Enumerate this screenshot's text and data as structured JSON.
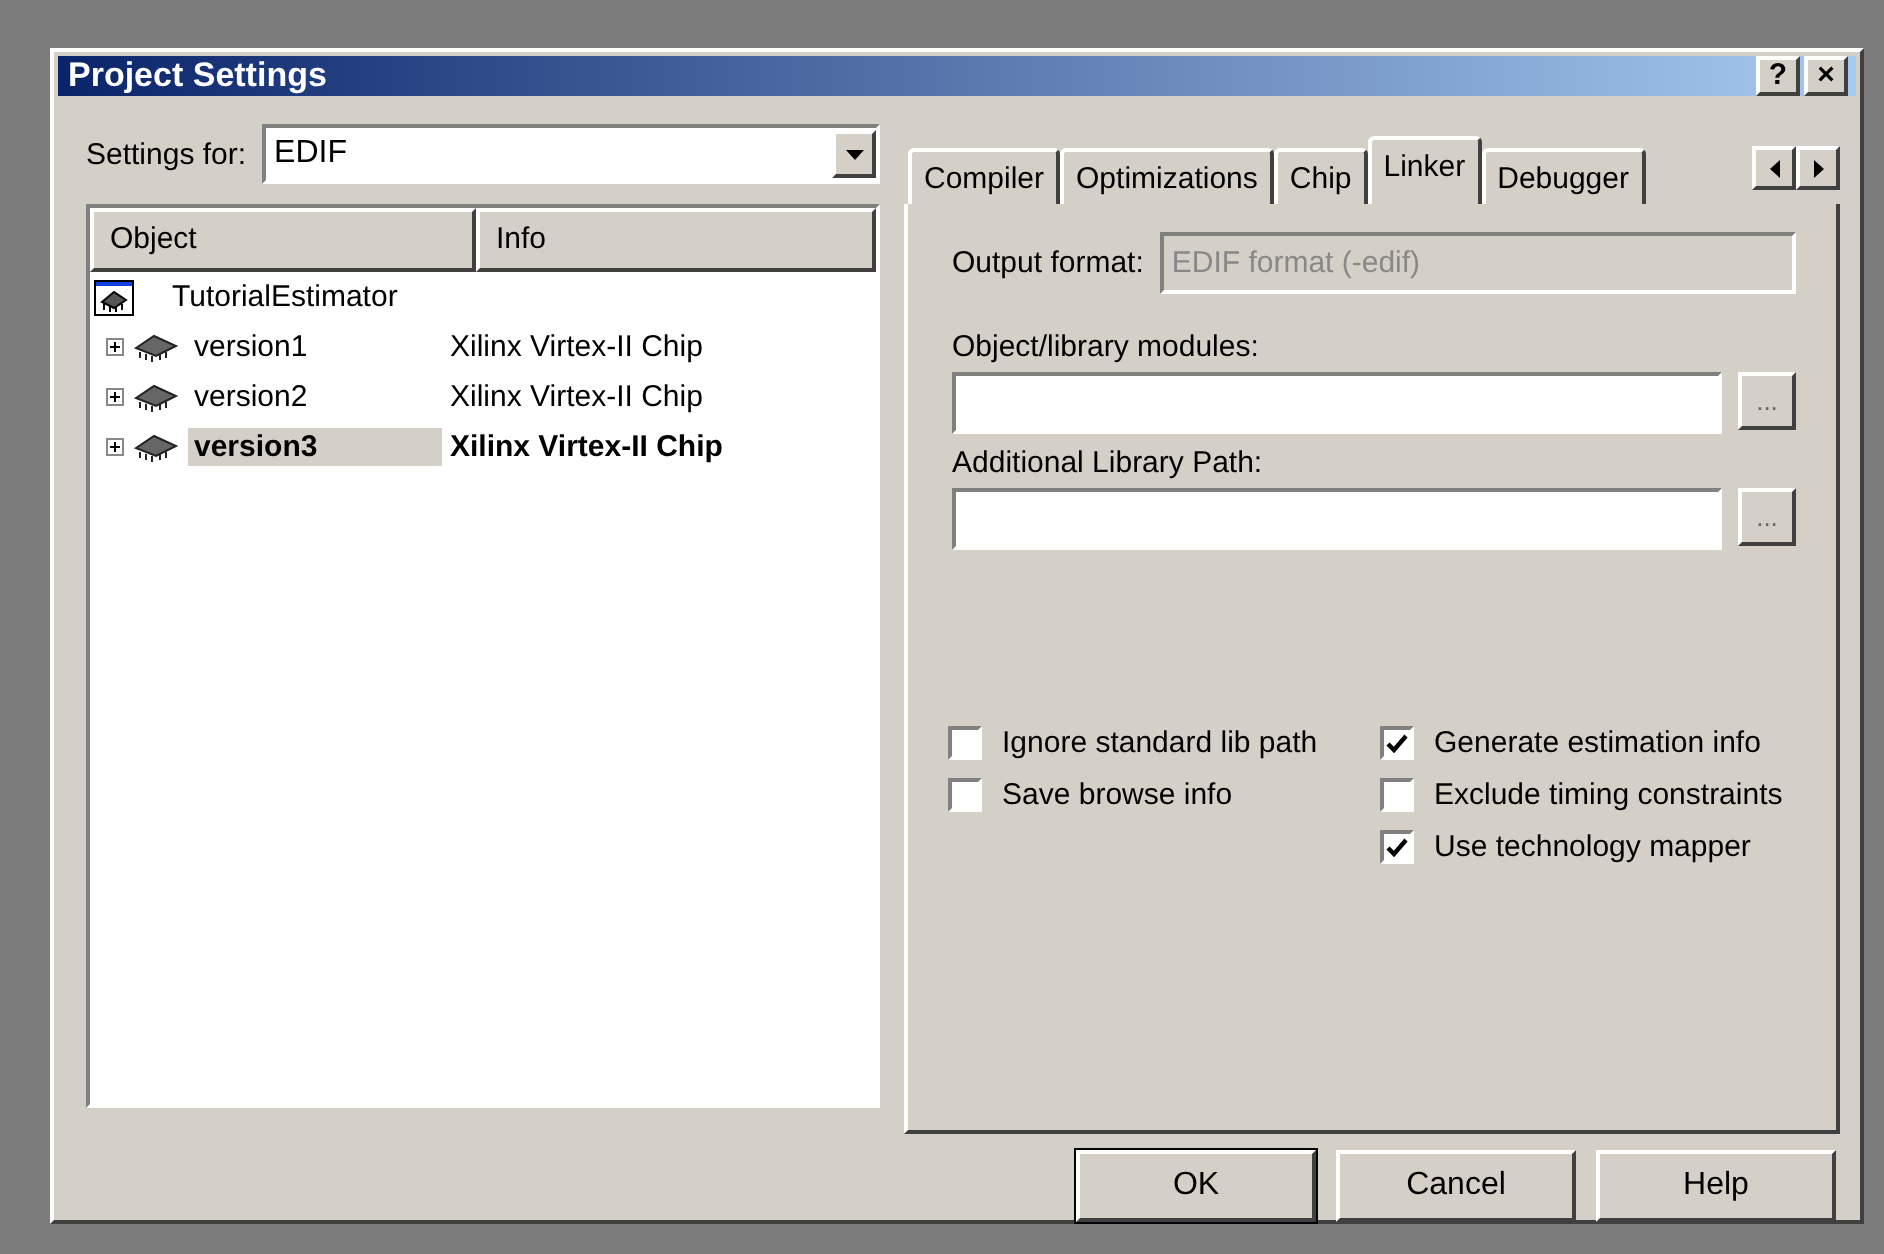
{
  "window": {
    "title": "Project Settings",
    "title_buttons": [
      "?",
      "×"
    ]
  },
  "settings_for": {
    "label": "Settings for:",
    "value": "EDIF"
  },
  "tree": {
    "columns": [
      "Object",
      "Info"
    ],
    "root": {
      "name": "TutorialEstimator",
      "selected": false,
      "children": [
        {
          "name": "version1",
          "info": "Xilinx Virtex-II Chip",
          "expanded": false,
          "selected": false
        },
        {
          "name": "version2",
          "info": "Xilinx Virtex-II Chip",
          "expanded": false,
          "selected": false
        },
        {
          "name": "version3",
          "info": "Xilinx Virtex-II Chip",
          "expanded": false,
          "selected": true
        }
      ]
    }
  },
  "tabs": [
    {
      "label": "Compiler",
      "selected": false
    },
    {
      "label": "Optimizations",
      "selected": false
    },
    {
      "label": "Chip",
      "selected": false
    },
    {
      "label": "Linker",
      "selected": true
    },
    {
      "label": "Debugger",
      "selected": false
    }
  ],
  "linker": {
    "output_format": {
      "label": "Output format:",
      "value": "EDIF format (-edif)",
      "disabled": true
    },
    "fields": [
      {
        "label": "Object/library modules:",
        "button": "..."
      },
      {
        "label": "Additional Library Path:",
        "button": "..."
      }
    ],
    "options_left": [
      {
        "label": "Ignore standard lib path",
        "checked": false
      },
      {
        "label": "Save browse info",
        "checked": false
      }
    ],
    "options_right": [
      {
        "label": "Generate estimation info",
        "checked": true
      },
      {
        "label": "Exclude timing constraints",
        "checked": false
      },
      {
        "label": "Use technology mapper",
        "checked": true
      }
    ]
  },
  "buttons": [
    {
      "label": "OK",
      "default": true
    },
    {
      "label": "Cancel",
      "default": false
    },
    {
      "label": "Help",
      "default": false
    }
  ]
}
